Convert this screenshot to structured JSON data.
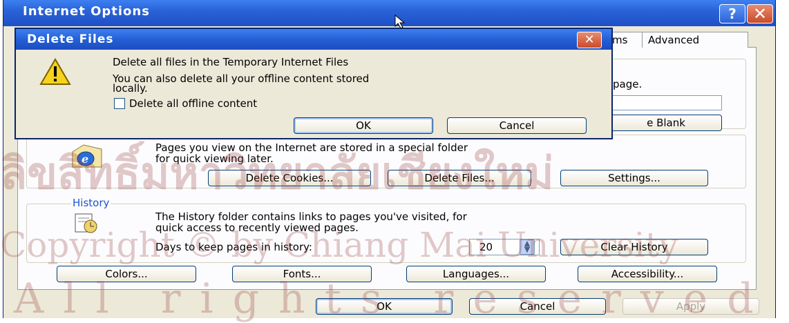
{
  "window": {
    "title": "Internet Options",
    "help_label": "?",
    "close_label": "✕"
  },
  "tabs": [
    {
      "label": "ms"
    },
    {
      "label": "Advanced"
    }
  ],
  "home_page": {
    "partial_text": "page.",
    "use_blank_label": "e Blank"
  },
  "temp_files": {
    "desc_line1": "Pages you view on the Internet are stored in a special folder",
    "desc_line2": "for quick viewing later.",
    "delete_cookies_label": "Delete Cookies...",
    "delete_files_label": "Delete Files...",
    "settings_label": "Settings..."
  },
  "history": {
    "legend": "History",
    "desc_line1": "The History folder contains links to pages you've visited, for",
    "desc_line2": "quick access to recently viewed pages.",
    "days_label": "Days to keep pages in history:",
    "days_value": "20",
    "clear_label": "Clear History"
  },
  "bottom_buttons": {
    "colors": "Colors...",
    "fonts": "Fonts...",
    "languages": "Languages...",
    "accessibility": "Accessibility..."
  },
  "dialog_buttons": {
    "ok": "OK",
    "cancel": "Cancel",
    "apply": "Apply"
  },
  "delete_dialog": {
    "title": "Delete Files",
    "close_label": "✕",
    "line1": "Delete all files in the Temporary Internet Files",
    "line2": "You can also delete all your offline content stored",
    "line3": "locally.",
    "checkbox_label": "Delete all offline content",
    "checkbox_checked": false,
    "ok_label": "OK",
    "cancel_label": "Cancel"
  },
  "watermark": {
    "line1": "ลิขสิทธิ์มหาวิทยาลัยเชียงใหม่",
    "line2": "Copyright © by Chiang Mai University",
    "line3": "All rights reserved"
  },
  "colors": {
    "titlebar": "#2a63d8",
    "face": "#ece9d8",
    "close": "#c94b2a"
  }
}
